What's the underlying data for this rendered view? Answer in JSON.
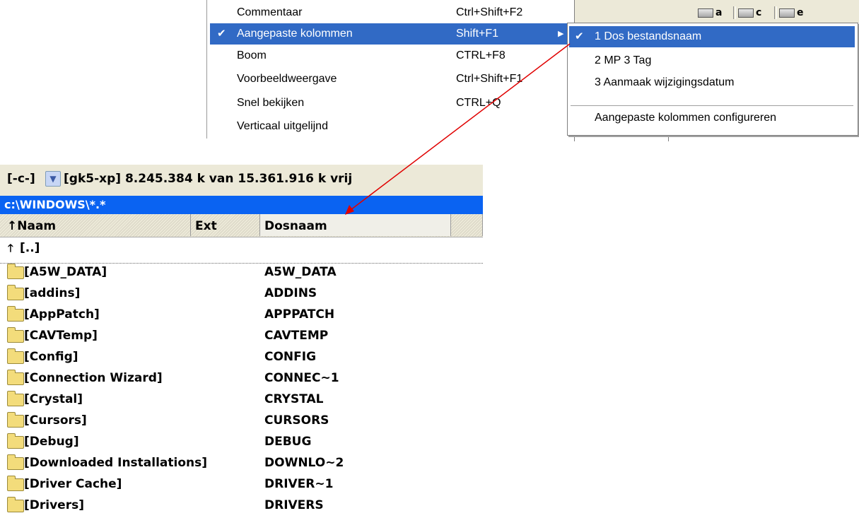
{
  "context_menu": {
    "items": [
      {
        "label": "Commentaar",
        "shortcut": "Ctrl+Shift+F2",
        "checked": false,
        "submenu": false,
        "active": false
      },
      {
        "label": "Aangepaste kolommen",
        "shortcut": "Shift+F1",
        "checked": true,
        "submenu": true,
        "active": true
      },
      {
        "label": "Boom",
        "shortcut": "CTRL+F8",
        "checked": false,
        "submenu": false,
        "active": false
      },
      {
        "label": "Voorbeeldweergave",
        "shortcut": "Ctrl+Shift+F1",
        "checked": false,
        "submenu": false,
        "active": false
      },
      {
        "label": "Snel bekijken",
        "shortcut": "CTRL+Q",
        "checked": false,
        "submenu": false,
        "active": false
      },
      {
        "label": "Verticaal uitgelijnd",
        "shortcut": "",
        "checked": false,
        "submenu": false,
        "active": false
      }
    ]
  },
  "submenu": {
    "items": [
      {
        "label": "1 Dos bestandsnaam",
        "checked": true,
        "active": true
      },
      {
        "label": "2 MP 3 Tag",
        "checked": false,
        "active": false
      },
      {
        "label": "3 Aanmaak  wijzigingsdatum",
        "checked": false,
        "active": false
      },
      {
        "label": "Aangepaste kolommen configureren",
        "checked": false,
        "active": false
      }
    ]
  },
  "toolbar": {
    "drives": [
      "a",
      "c",
      "e"
    ]
  },
  "panel": {
    "drive_selector": "[-c-]",
    "drive_info": "[gk5-xp]  8.245.384 k van 15.361.916 k vrij",
    "path": "c:\\WINDOWS\\*.*",
    "columns": {
      "name": "↑Naam",
      "ext": "Ext",
      "dosname": "Dosnaam"
    },
    "parent_row": "[..]",
    "rows": [
      {
        "name": "[A5W_DATA]",
        "dos": "A5W_DATA"
      },
      {
        "name": "[addins]",
        "dos": "ADDINS"
      },
      {
        "name": "[AppPatch]",
        "dos": "APPPATCH"
      },
      {
        "name": "[CAVTemp]",
        "dos": "CAVTEMP"
      },
      {
        "name": "[Config]",
        "dos": "CONFIG"
      },
      {
        "name": "[Connection Wizard]",
        "dos": "CONNEC~1"
      },
      {
        "name": "[Crystal]",
        "dos": "CRYSTAL"
      },
      {
        "name": "[Cursors]",
        "dos": "CURSORS"
      },
      {
        "name": "[Debug]",
        "dos": "DEBUG"
      },
      {
        "name": "[Downloaded Installations]",
        "dos": "DOWNLO~2"
      },
      {
        "name": "[Driver Cache]",
        "dos": "DRIVER~1"
      },
      {
        "name": "[Drivers]",
        "dos": "DRIVERS"
      }
    ]
  },
  "colors": {
    "highlight": "#316ac5",
    "path_bar": "#0a63f2",
    "annotation_arrow": "#e00000"
  }
}
